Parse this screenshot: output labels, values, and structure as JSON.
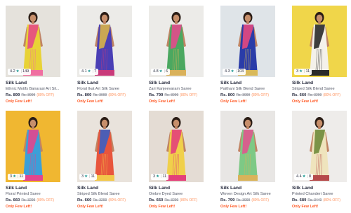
{
  "products": [
    {
      "brand": "Silk Land",
      "name": "Ethnic Motifs Banarasi Art Sil...",
      "price": "Rs. 899",
      "mrp": "Rs. 3999",
      "discount": "(80% OFF)",
      "stock": "Only Few Left!",
      "rating": "4.2",
      "reviews": "149",
      "bg": "#e5e2dc",
      "saree": "#e8d236",
      "accent": "#e54a85",
      "border": "#f06fa0"
    },
    {
      "brand": "Silk Land",
      "name": "Floral Ikat Art Silk Saree",
      "price": "Rs. 800",
      "mrp": "Rs. 3999",
      "discount": "(80% OFF)",
      "stock": "Only Few Left!",
      "rating": "4.1",
      "reviews": "7",
      "bg": "#ecebe8",
      "saree": "#4a3fb5",
      "accent": "#d8b348",
      "border": "#c93a7a"
    },
    {
      "brand": "Silk Land",
      "name": "Zari Kanjeevaram Saree",
      "price": "Rs. 799",
      "mrp": "Rs. 3999",
      "discount": "(80% OFF)",
      "stock": "Only Few Left!",
      "rating": "4.8",
      "reviews": "6",
      "bg": "#ecebe8",
      "saree": "#4ba860",
      "accent": "#e24a8c",
      "border": "#d9b15a"
    },
    {
      "brand": "Silk Land",
      "name": "Paithani Silk Blend Saree",
      "price": "Rs. 800",
      "mrp": "Rs. 3999",
      "discount": "(80% OFF)",
      "stock": "Only Few Left!",
      "rating": "4.3",
      "reviews": "103",
      "bg": "#dfe4e8",
      "saree": "#2a3ca8",
      "accent": "#e4487e",
      "border": "#d9b95a"
    },
    {
      "brand": "Silk Land",
      "name": "Striped Silk Blend Saree",
      "price": "Rs. 660",
      "mrp": "Rs. 3299",
      "discount": "(80% OFF)",
      "stock": "Only Few Left!",
      "rating": "3",
      "reviews": "11",
      "bg": "#f0d64a",
      "saree": "#f4f1ea",
      "accent": "#2a2a2a",
      "border": "#2a2a2a"
    },
    {
      "brand": "Silk Land",
      "name": "Floral Printed Saree",
      "price": "Rs. 660",
      "mrp": "Rs. 3299",
      "discount": "(80% OFF)",
      "stock": "Only Few Left!",
      "rating": "3",
      "reviews": "11",
      "bg": "#f0b731",
      "saree": "#3c9fd8",
      "accent": "#e2468e",
      "border": "#e2468e"
    },
    {
      "brand": "Silk Land",
      "name": "Striped Silk Blend Saree",
      "price": "Rs. 660",
      "mrp": "Rs. 3299",
      "discount": "(80% OFF)",
      "stock": "Only Few Left!",
      "rating": "3",
      "reviews": "11",
      "bg": "#e9e3dc",
      "saree": "#e8553c",
      "accent": "#3b5fc2",
      "border": "#f2c84a"
    },
    {
      "brand": "Silk Land",
      "name": "Ombre Dyed Saree",
      "price": "Rs. 660",
      "mrp": "Rs. 3299",
      "discount": "(80% OFF)",
      "stock": "Only Few Left!",
      "rating": "3",
      "reviews": "11",
      "bg": "#e4dcd4",
      "saree": "#f0d04a",
      "accent": "#e3407a",
      "border": "#e3407a"
    },
    {
      "brand": "Silk Land",
      "name": "Woven Design Art Silk Saree",
      "price": "Rs. 799",
      "mrp": "Rs. 3999",
      "discount": "(80% OFF)",
      "stock": "Only Few Left!",
      "rating": "",
      "reviews": "",
      "bg": "#e8e6e4",
      "saree": "#7dc985",
      "accent": "#e0558e",
      "border": "#d9b35a"
    },
    {
      "brand": "Silk Land",
      "name": "Printed Chanderi Saree",
      "price": "Rs. 689",
      "mrp": "Rs. 3449",
      "discount": "(80% OFF)",
      "stock": "Only Few Left!",
      "rating": "4.4",
      "reviews": "8",
      "bg": "#eeecea",
      "saree": "#efe4bd",
      "accent": "#6e8a3a",
      "border": "#b64a4a"
    }
  ]
}
